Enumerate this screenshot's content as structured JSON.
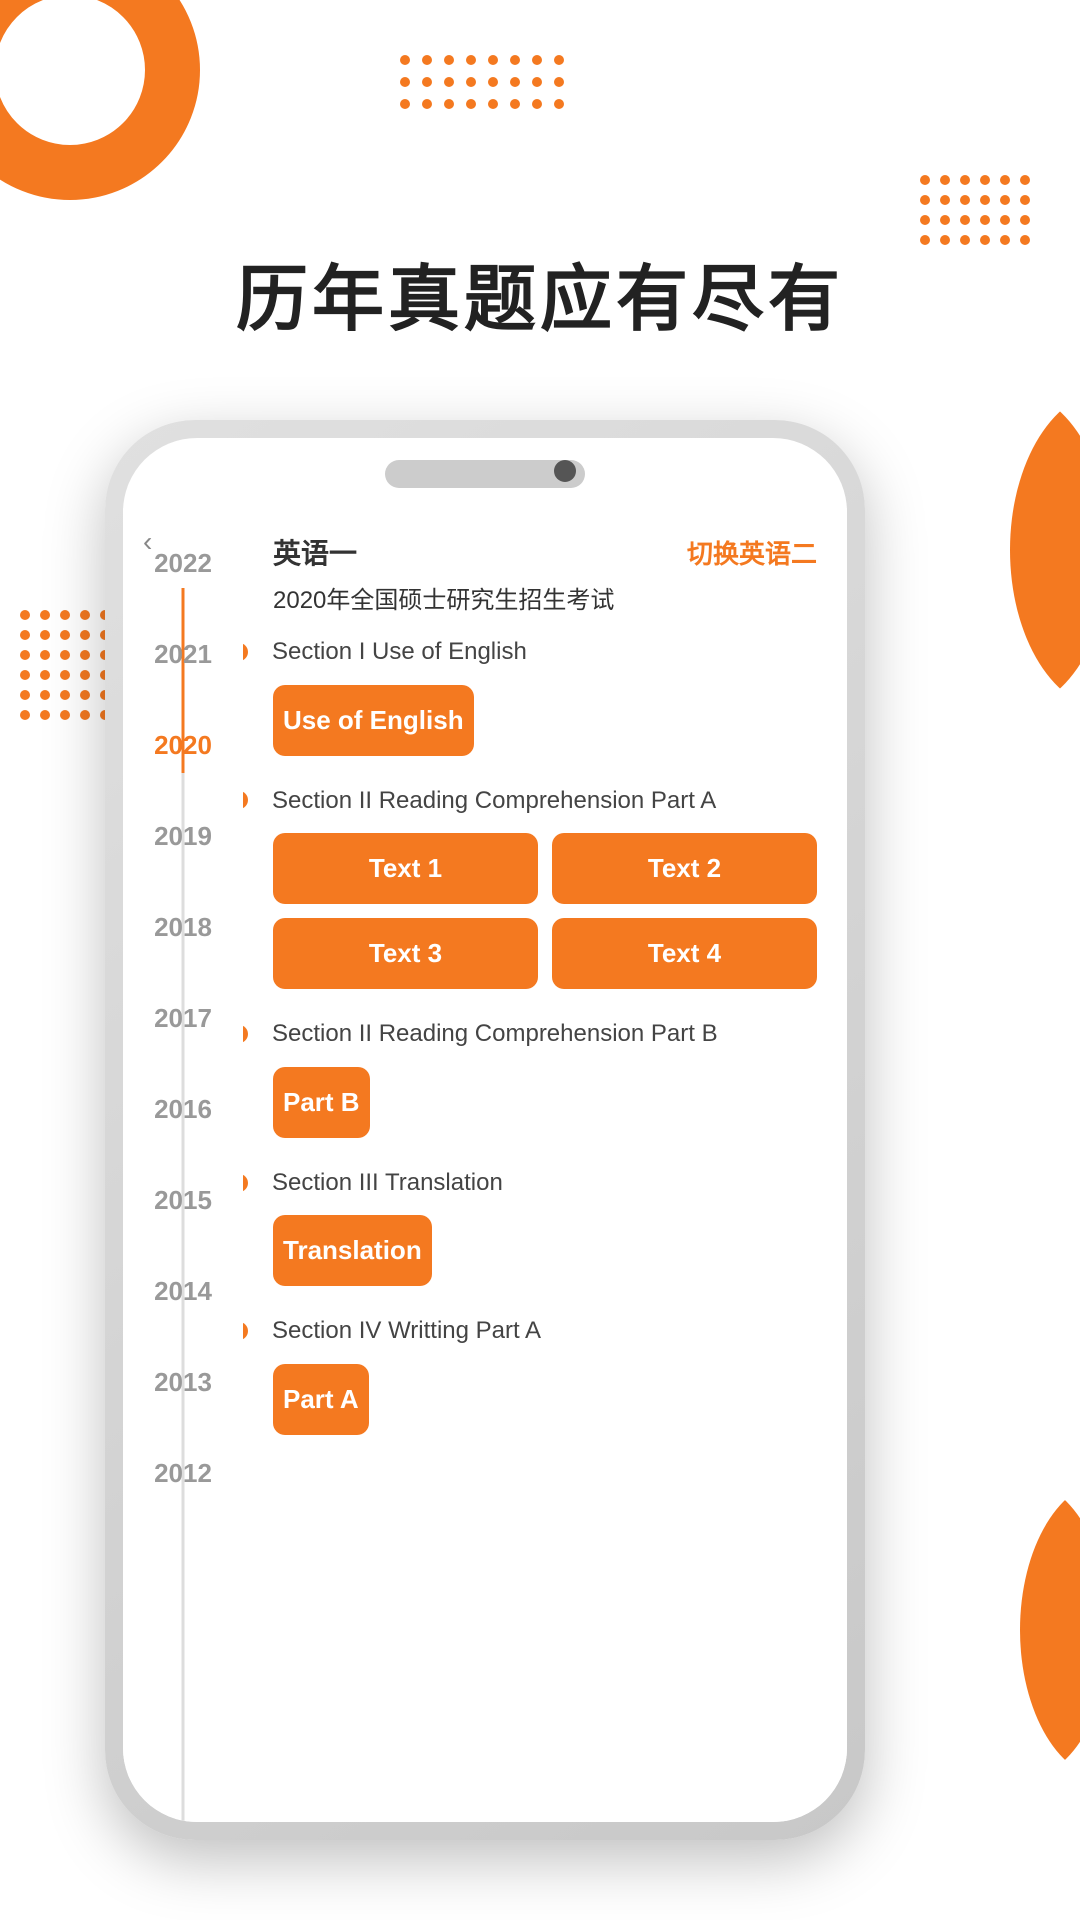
{
  "page": {
    "title": "历年真题应有尽有",
    "background": {
      "accent_color": "#F47920"
    }
  },
  "phone": {
    "header": {
      "subject": "英语一",
      "switch_label": "切换英语二",
      "exam_title": "2020年全国硕士研究生招生考试"
    },
    "timeline": {
      "years": [
        "2022",
        "2021",
        "2020",
        "2019",
        "2018",
        "2017",
        "2016",
        "2015",
        "2014",
        "2013",
        "2012"
      ],
      "active_year": "2020",
      "back_icon": "‹"
    },
    "sections": [
      {
        "id": "section1",
        "title": "Section I Use of English",
        "dot": true,
        "buttons": [
          {
            "label": "Use of English"
          }
        ],
        "grid": "single"
      },
      {
        "id": "section2a",
        "title": "Section II Reading Comprehension Part A",
        "dot": true,
        "buttons": [
          {
            "label": "Text 1"
          },
          {
            "label": "Text 2"
          },
          {
            "label": "Text 3"
          },
          {
            "label": "Text 4"
          }
        ],
        "grid": "double"
      },
      {
        "id": "section2b",
        "title": "Section II Reading Comprehension Part B",
        "dot": true,
        "buttons": [
          {
            "label": "Part B"
          }
        ],
        "grid": "single"
      },
      {
        "id": "section3",
        "title": "Section III Translation",
        "dot": true,
        "buttons": [
          {
            "label": "Translation"
          }
        ],
        "grid": "single"
      },
      {
        "id": "section4",
        "title": "Section IV Writting Part A",
        "dot": true,
        "buttons": [
          {
            "label": "Part A"
          }
        ],
        "grid": "single"
      }
    ]
  }
}
